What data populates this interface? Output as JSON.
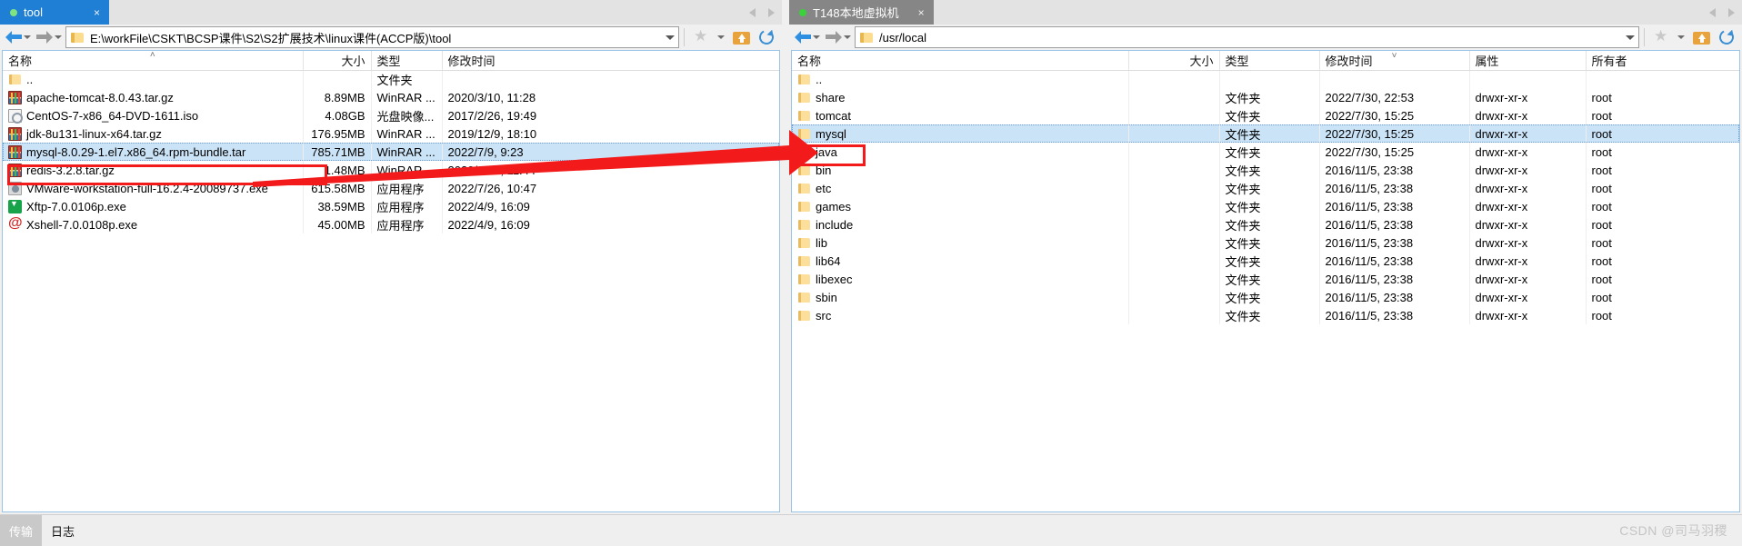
{
  "left_pane": {
    "tab": {
      "label": "tool",
      "close_label": "×",
      "status_dot": "green-dot-icon"
    },
    "tabstrip_nav": {
      "prev": "prev-tab-icon",
      "next": "next-tab-icon"
    },
    "toolbar": {
      "back": "back-arrow-icon",
      "back_caret": "chevron-down-icon",
      "forward": "forward-arrow-icon",
      "forward_caret": "chevron-down-icon",
      "folder_icon": "folder-icon",
      "path": "E:\\workFile\\CSKT\\BCSP课件\\S2\\S2扩展技术\\linux课件(ACCP版)\\tool",
      "path_dropdown": "chevron-down-icon",
      "bookmark": "star-icon",
      "bookmark_caret": "chevron-down-icon",
      "parent_folder": "up-folder-icon",
      "refresh": "refresh-icon"
    },
    "columns": [
      {
        "key": "name",
        "label": "名称",
        "align": "left"
      },
      {
        "key": "size",
        "label": "大小",
        "align": "right"
      },
      {
        "key": "type",
        "label": "类型",
        "align": "left"
      },
      {
        "key": "mtime",
        "label": "修改时间",
        "align": "left"
      }
    ],
    "sort_indicator": "˄",
    "rows": [
      {
        "icon": "folder-icon",
        "name": "..",
        "size": "",
        "type": "文件夹",
        "mtime": "",
        "selected": false
      },
      {
        "icon": "rar-icon",
        "name": "apache-tomcat-8.0.43.tar.gz",
        "size": "8.89MB",
        "type": "WinRAR ...",
        "mtime": "2020/3/10, 11:28",
        "selected": false
      },
      {
        "icon": "iso-icon",
        "name": "CentOS-7-x86_64-DVD-1611.iso",
        "size": "4.08GB",
        "type": "光盘映像...",
        "mtime": "2017/2/26, 19:49",
        "selected": false
      },
      {
        "icon": "rar-icon",
        "name": "jdk-8u131-linux-x64.tar.gz",
        "size": "176.95MB",
        "type": "WinRAR ...",
        "mtime": "2019/12/9, 18:10",
        "selected": false
      },
      {
        "icon": "rar-icon",
        "name": "mysql-8.0.29-1.el7.x86_64.rpm-bundle.tar",
        "size": "785.71MB",
        "type": "WinRAR ...",
        "mtime": "2022/7/9, 9:23",
        "selected": true
      },
      {
        "icon": "rar-icon",
        "name": "redis-3.2.8.tar.gz",
        "size": "1.48MB",
        "type": "WinRAR ...",
        "mtime": "2020/8/27, 11:44",
        "selected": false
      },
      {
        "icon": "vmware-icon",
        "name": "VMware-workstation-full-16.2.4-20089737.exe",
        "size": "615.58MB",
        "type": "应用程序",
        "mtime": "2022/7/26, 10:47",
        "selected": false
      },
      {
        "icon": "xftp-icon",
        "name": "Xftp-7.0.0106p.exe",
        "size": "38.59MB",
        "type": "应用程序",
        "mtime": "2022/4/9, 16:09",
        "selected": false
      },
      {
        "icon": "xshell-icon",
        "name": "Xshell-7.0.0108p.exe",
        "size": "45.00MB",
        "type": "应用程序",
        "mtime": "2022/4/9, 16:09",
        "selected": false
      }
    ]
  },
  "right_pane": {
    "tab": {
      "label": "T148本地虚拟机",
      "close_label": "×",
      "status_dot": "green-dot-icon"
    },
    "tabstrip_nav": {
      "prev": "prev-tab-icon",
      "next": "next-tab-icon"
    },
    "toolbar": {
      "back": "back-arrow-icon",
      "back_caret": "chevron-down-icon",
      "forward": "forward-arrow-icon",
      "forward_caret": "chevron-down-icon",
      "folder_icon": "folder-icon",
      "path": "/usr/local",
      "path_dropdown": "chevron-down-icon",
      "bookmark": "star-icon",
      "bookmark_caret": "chevron-down-icon",
      "parent_folder": "up-folder-icon",
      "refresh": "refresh-icon"
    },
    "columns": [
      {
        "key": "name",
        "label": "名称",
        "align": "left"
      },
      {
        "key": "size",
        "label": "大小",
        "align": "right"
      },
      {
        "key": "type",
        "label": "类型",
        "align": "left"
      },
      {
        "key": "mtime",
        "label": "修改时间",
        "align": "left"
      },
      {
        "key": "attrs",
        "label": "属性",
        "align": "left"
      },
      {
        "key": "owner",
        "label": "所有者",
        "align": "left"
      }
    ],
    "sort_indicator": "˅",
    "rows": [
      {
        "icon": "folder-icon",
        "name": "..",
        "size": "",
        "type": "",
        "mtime": "",
        "attrs": "",
        "owner": "",
        "highlight": false
      },
      {
        "icon": "folder-icon",
        "name": "share",
        "size": "",
        "type": "文件夹",
        "mtime": "2022/7/30, 22:53",
        "attrs": "drwxr-xr-x",
        "owner": "root",
        "highlight": false
      },
      {
        "icon": "folder-icon",
        "name": "tomcat",
        "size": "",
        "type": "文件夹",
        "mtime": "2022/7/30, 15:25",
        "attrs": "drwxr-xr-x",
        "owner": "root",
        "highlight": false
      },
      {
        "icon": "folder-icon",
        "name": "mysql",
        "size": "",
        "type": "文件夹",
        "mtime": "2022/7/30, 15:25",
        "attrs": "drwxr-xr-x",
        "owner": "root",
        "highlight": true
      },
      {
        "icon": "folder-icon",
        "name": "java",
        "size": "",
        "type": "文件夹",
        "mtime": "2022/7/30, 15:25",
        "attrs": "drwxr-xr-x",
        "owner": "root",
        "highlight": false
      },
      {
        "icon": "folder-icon",
        "name": "bin",
        "size": "",
        "type": "文件夹",
        "mtime": "2016/11/5, 23:38",
        "attrs": "drwxr-xr-x",
        "owner": "root",
        "highlight": false
      },
      {
        "icon": "folder-icon",
        "name": "etc",
        "size": "",
        "type": "文件夹",
        "mtime": "2016/11/5, 23:38",
        "attrs": "drwxr-xr-x",
        "owner": "root",
        "highlight": false
      },
      {
        "icon": "folder-icon",
        "name": "games",
        "size": "",
        "type": "文件夹",
        "mtime": "2016/11/5, 23:38",
        "attrs": "drwxr-xr-x",
        "owner": "root",
        "highlight": false
      },
      {
        "icon": "folder-icon",
        "name": "include",
        "size": "",
        "type": "文件夹",
        "mtime": "2016/11/5, 23:38",
        "attrs": "drwxr-xr-x",
        "owner": "root",
        "highlight": false
      },
      {
        "icon": "folder-icon",
        "name": "lib",
        "size": "",
        "type": "文件夹",
        "mtime": "2016/11/5, 23:38",
        "attrs": "drwxr-xr-x",
        "owner": "root",
        "highlight": false
      },
      {
        "icon": "folder-icon",
        "name": "lib64",
        "size": "",
        "type": "文件夹",
        "mtime": "2016/11/5, 23:38",
        "attrs": "drwxr-xr-x",
        "owner": "root",
        "highlight": false
      },
      {
        "icon": "folder-icon",
        "name": "libexec",
        "size": "",
        "type": "文件夹",
        "mtime": "2016/11/5, 23:38",
        "attrs": "drwxr-xr-x",
        "owner": "root",
        "highlight": false
      },
      {
        "icon": "folder-icon",
        "name": "sbin",
        "size": "",
        "type": "文件夹",
        "mtime": "2016/11/5, 23:38",
        "attrs": "drwxr-xr-x",
        "owner": "root",
        "highlight": false
      },
      {
        "icon": "folder-icon",
        "name": "src",
        "size": "",
        "type": "文件夹",
        "mtime": "2016/11/5, 23:38",
        "attrs": "drwxr-xr-x",
        "owner": "root",
        "highlight": false
      }
    ]
  },
  "statusbar": {
    "transfer_label": "传输",
    "log_label": "日志",
    "watermark": "CSDN @司马羽稷"
  },
  "annotations": {
    "accent_color": "#f21a1a",
    "left_box": "highlight-box-mysql-tar",
    "right_box": "highlight-box-mysql-folder",
    "arrow": "red-arrow-annotation"
  }
}
